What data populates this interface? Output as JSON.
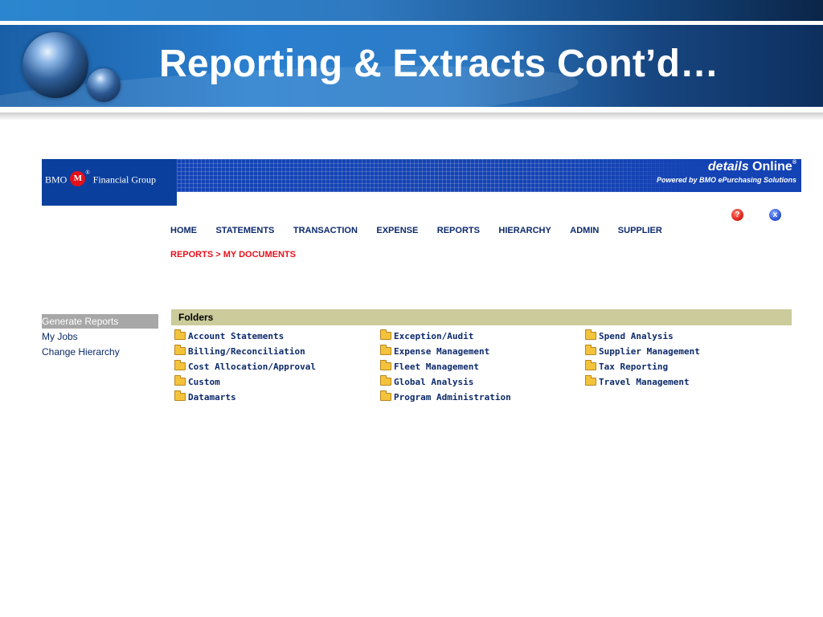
{
  "slide": {
    "title": "Reporting & Extracts Cont’d…"
  },
  "app": {
    "bank_name_left": "BMO",
    "bank_name_right": "Financial Group",
    "bank_roundel": "M",
    "bank_trademark": "®",
    "brand_italic": "details ",
    "brand_plain": "Online",
    "brand_registered": "®",
    "tagline": "Powered by BMO ePurchasing Solutions",
    "help_glyph": "?",
    "close_glyph": "x"
  },
  "nav": {
    "items": [
      "HOME",
      "STATEMENTS",
      "TRANSACTION",
      "EXPENSE",
      "REPORTS",
      "HIERARCHY",
      "ADMIN",
      "SUPPLIER"
    ]
  },
  "breadcrumb": "REPORTS > MY DOCUMENTS",
  "sidebar": {
    "header": "Generate Reports",
    "links": [
      "My Jobs",
      "Change Hierarchy"
    ]
  },
  "folders": {
    "title": "Folders",
    "columns": [
      [
        "Account Statements",
        "Billing/Reconciliation",
        "Cost Allocation/Approval",
        "Custom",
        "Datamarts"
      ],
      [
        "Exception/Audit",
        "Expense Management",
        "Fleet Management",
        "Global Analysis",
        "Program Administration"
      ],
      [
        "Spend Analysis",
        "Supplier Management",
        "Tax Reporting",
        "Travel Management"
      ]
    ]
  },
  "colors": {
    "slide_blue": "#2a7fcf",
    "banner_blue": "#1443b4",
    "nav_text": "#0d2a6b",
    "breadcrumb_red": "#e8101c",
    "folders_bar": "#cbcb9b",
    "sidebar_header": "#a7a7a7"
  },
  "icons": {
    "folder": "folder-icon",
    "help": "help-icon",
    "close": "close-icon",
    "globe": "globe-icon"
  }
}
